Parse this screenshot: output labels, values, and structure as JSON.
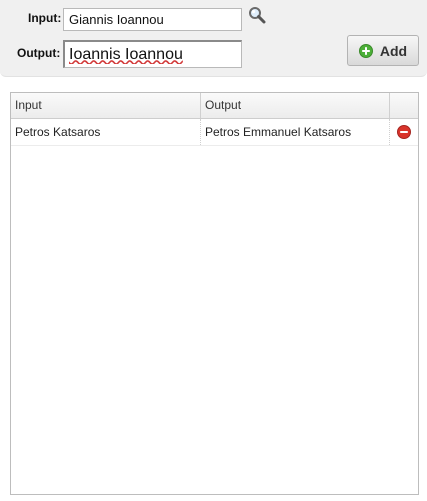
{
  "form": {
    "input_label": "Input:",
    "input_value": "Giannis Ioannou",
    "output_label": "Output:",
    "output_value": "Ioannis Ioannou",
    "search_icon": "search-icon",
    "add_icon": "plus-circle-icon",
    "add_label": "Add"
  },
  "grid": {
    "columns": [
      "Input",
      "Output",
      ""
    ],
    "rows": [
      {
        "input": "Petros Katsaros",
        "output": "Petros Emmanuel Katsaros",
        "action_icon": "remove-icon"
      }
    ]
  },
  "colors": {
    "add_icon_green": "#4caf38",
    "remove_icon_red": "#d9342b",
    "panel_background": "#f0f0f0"
  }
}
